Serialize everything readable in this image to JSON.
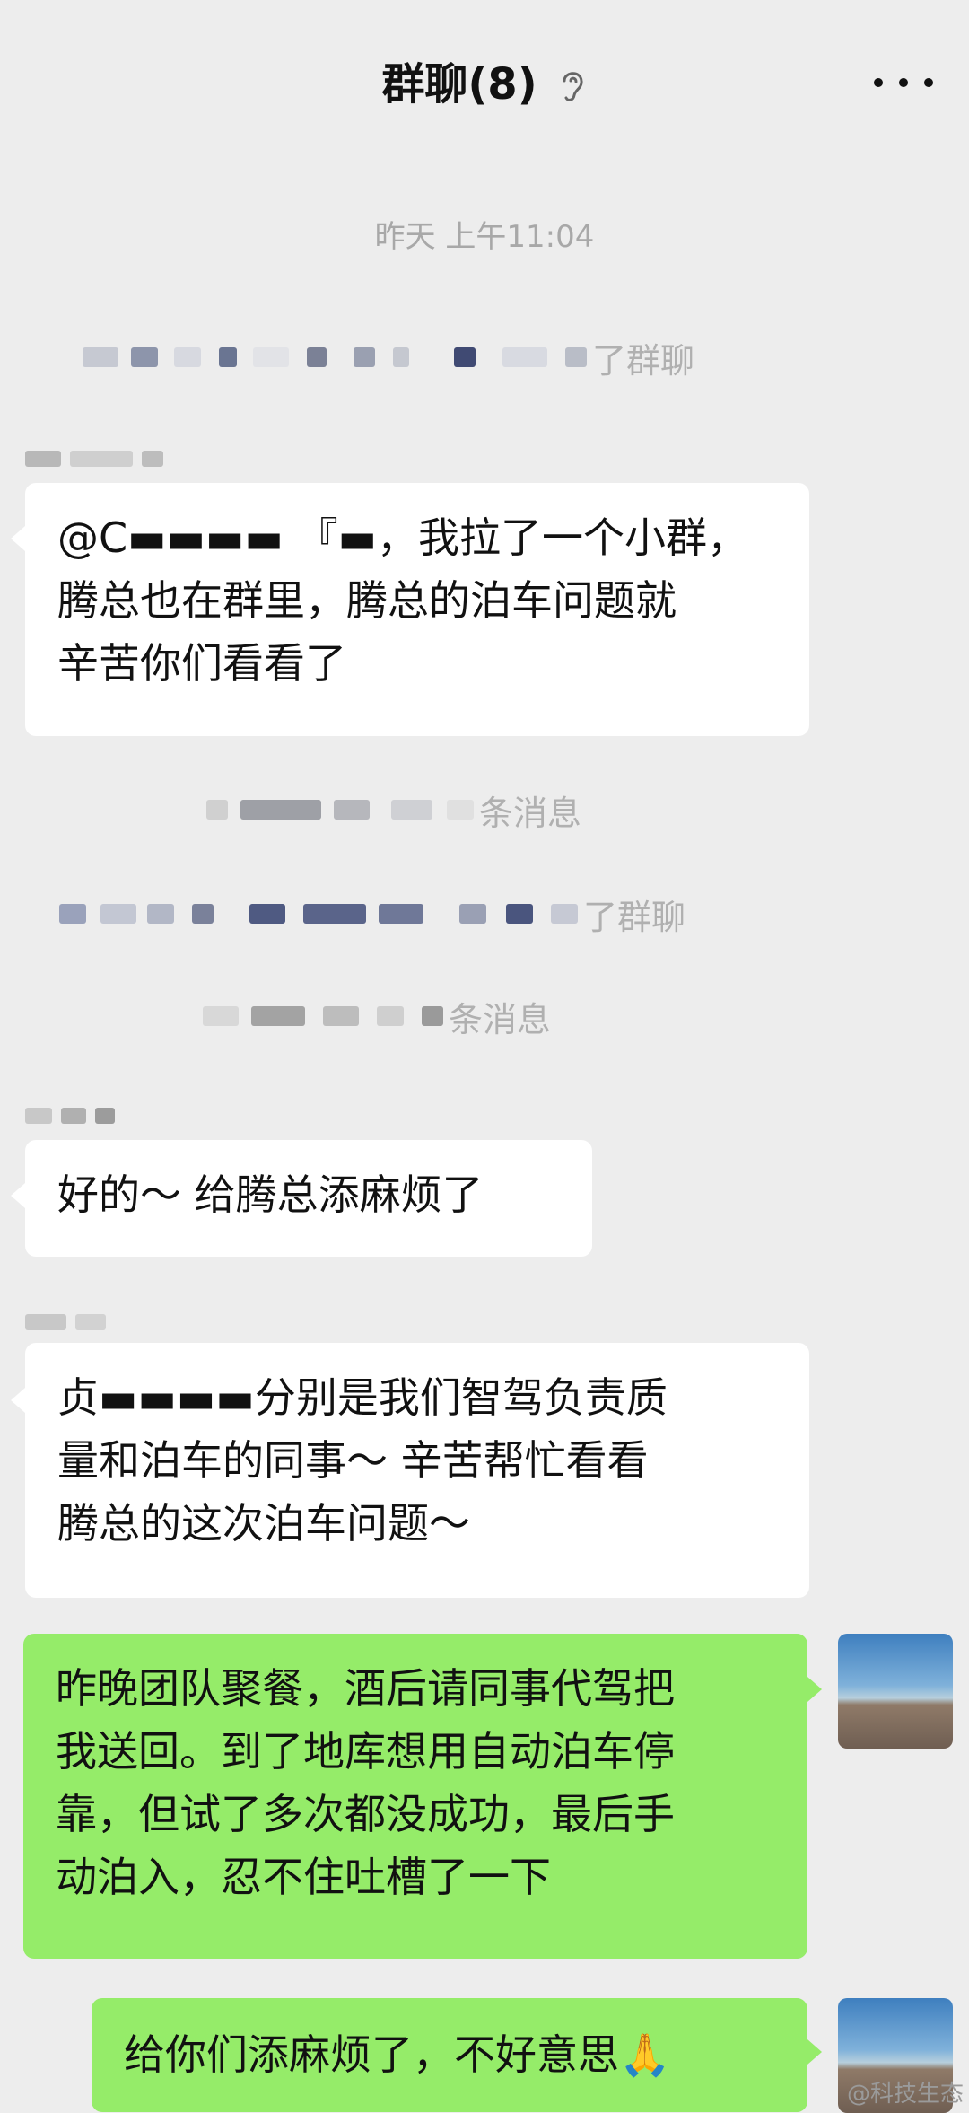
{
  "header": {
    "title": "群聊(8)",
    "ear_icon": "ear-icon",
    "more_icon": "more-dots-icon"
  },
  "chat": {
    "timestamp": "昨天 上午11:04",
    "system_messages": [
      {
        "text": "了群聊"
      },
      {
        "text": "条消息"
      },
      {
        "text": "了群聊"
      },
      {
        "text": "条消息"
      }
    ],
    "messages": [
      {
        "side": "left",
        "lines": [
          "@C▬▬▬▬ 『▬，我拉了一个小群，",
          "腾总也在群里，腾总的泊车问题就",
          "辛苦你们看看了"
        ]
      },
      {
        "side": "left",
        "lines": [
          "好的～ 给腾总添麻烦了"
        ]
      },
      {
        "side": "left",
        "lines": [
          "贞▬▬▬▬分别是我们智驾负责质",
          "量和泊车的同事～ 辛苦帮忙看看",
          "腾总的这次泊车问题～"
        ]
      },
      {
        "side": "right",
        "lines": [
          "昨晚团队聚餐，酒后请同事代驾把",
          "我送回。到了地库想用自动泊车停",
          "靠，但试了多次都没成功，最后手",
          "动泊入，忍不住吐槽了一下"
        ]
      },
      {
        "side": "right",
        "text": "给你们添麻烦了，不好意思",
        "emoji": "🙏"
      }
    ]
  },
  "watermark": "@科技生态",
  "colors": {
    "background": "#ededed",
    "bubble_white": "#ffffff",
    "bubble_green": "#95ec69"
  }
}
